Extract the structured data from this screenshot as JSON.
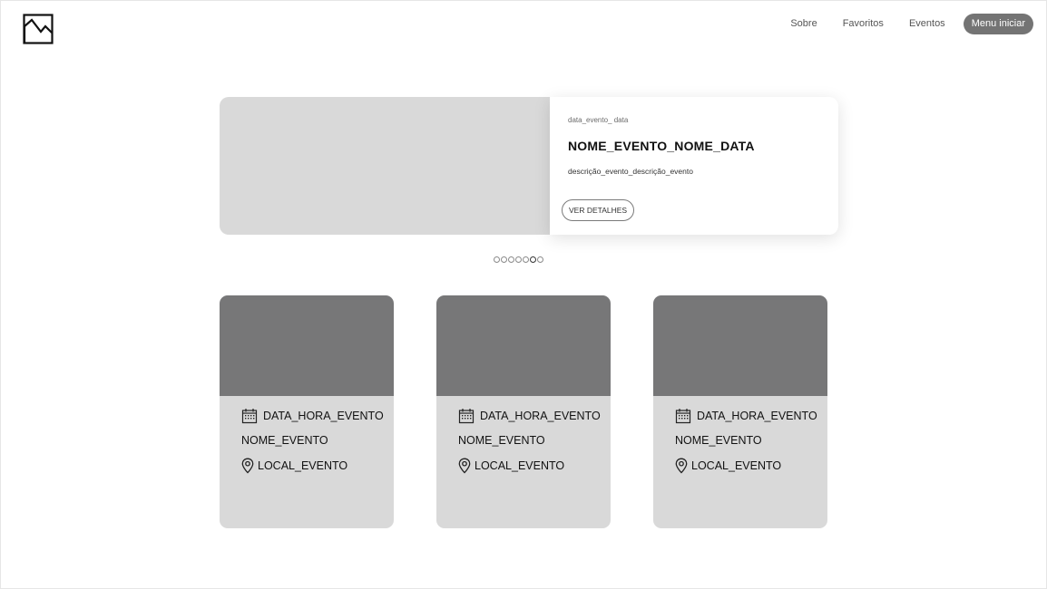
{
  "header": {
    "logo_icon": "image-placeholder-icon",
    "nav": [
      {
        "label": "Sobre"
      },
      {
        "label": "Favoritos"
      },
      {
        "label": "Eventos"
      }
    ],
    "menu_button": "Menu iniciar"
  },
  "hero": {
    "date": "data_evento_ data",
    "title": "NOME_EVENTO_NOME_DATA",
    "description": "descrição_evento_descrição_evento",
    "button": "VER DETALHES"
  },
  "carousel": {
    "total": 7,
    "active_index": 5
  },
  "cards": [
    {
      "date": "DATA_HORA_EVENTO",
      "name": "NOME_EVENTO",
      "location": "LOCAL_EVENTO"
    },
    {
      "date": "DATA_HORA_EVENTO",
      "name": "NOME_EVENTO",
      "location": "LOCAL_EVENTO"
    },
    {
      "date": "DATA_HORA_EVENTO",
      "name": "NOME_EVENTO",
      "location": "LOCAL_EVENTO"
    }
  ],
  "colors": {
    "image_placeholder": "#d9d9d9",
    "card_image": "#777778",
    "menu_button_bg": "#747474"
  },
  "icons": {
    "date": "calendar-icon",
    "location": "location-pin-icon"
  }
}
